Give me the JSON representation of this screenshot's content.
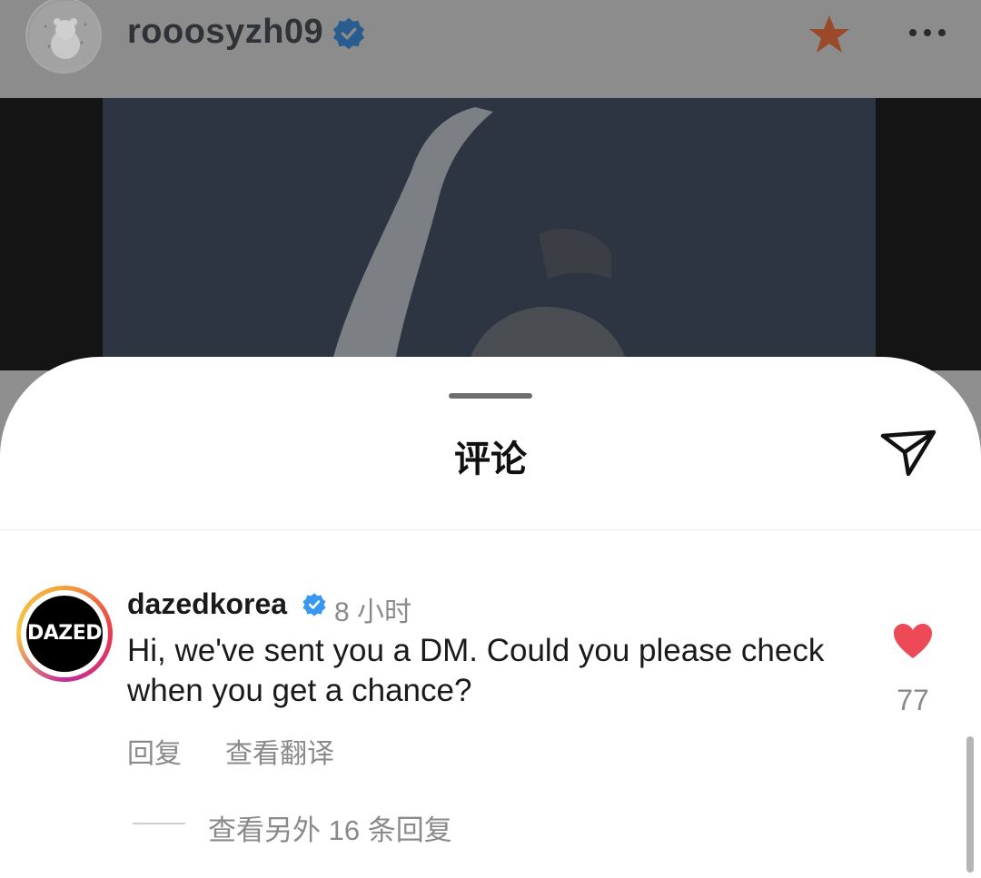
{
  "header": {
    "username": "rooosyzh09"
  },
  "sheet": {
    "title": "评论"
  },
  "comment": {
    "avatar_text": "DAZED",
    "username": "dazedkorea",
    "time": "8 小时",
    "text": "Hi, we've sent you a DM. Could you please check when you get a chance?",
    "reply_label": "回复",
    "translate_label": "查看翻译",
    "like_count": "77",
    "more_replies_label": "查看另外 16 条回复"
  },
  "colors": {
    "verified": "#3897f0",
    "heart": "#ed4956",
    "star": "#e8643c"
  }
}
